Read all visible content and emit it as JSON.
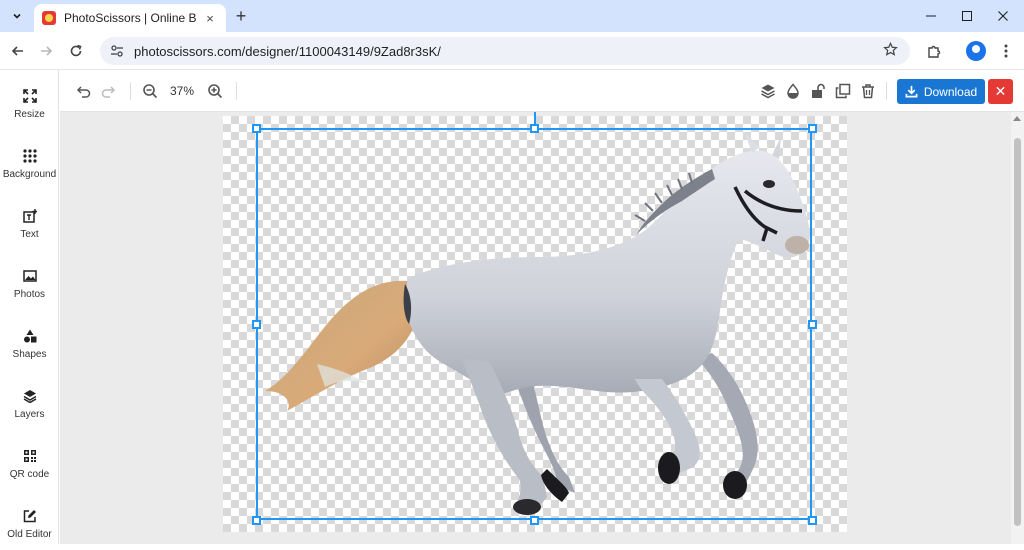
{
  "browser": {
    "tab_title": "PhotoScissors | Online Backgro",
    "tab_close": "×",
    "new_tab": "+",
    "url": "photoscissors.com/designer/1100043149/9Zad8r3sK/"
  },
  "sidebar": {
    "items": [
      {
        "label": "Resize",
        "icon": "resize-icon"
      },
      {
        "label": "Background",
        "icon": "grid-dots-icon"
      },
      {
        "label": "Text",
        "icon": "text-add-icon"
      },
      {
        "label": "Photos",
        "icon": "image-icon"
      },
      {
        "label": "Shapes",
        "icon": "shapes-icon"
      },
      {
        "label": "Layers",
        "icon": "layers-icon"
      },
      {
        "label": "QR code",
        "icon": "qr-code-icon"
      },
      {
        "label": "Old Editor",
        "icon": "edit-icon"
      }
    ]
  },
  "editor_toolbar": {
    "zoom_level": "37%",
    "download_label": "Download",
    "close_label": "✕"
  },
  "colors": {
    "accent": "#2196f3",
    "download_bg": "#1976d2",
    "close_bg": "#e53935"
  }
}
